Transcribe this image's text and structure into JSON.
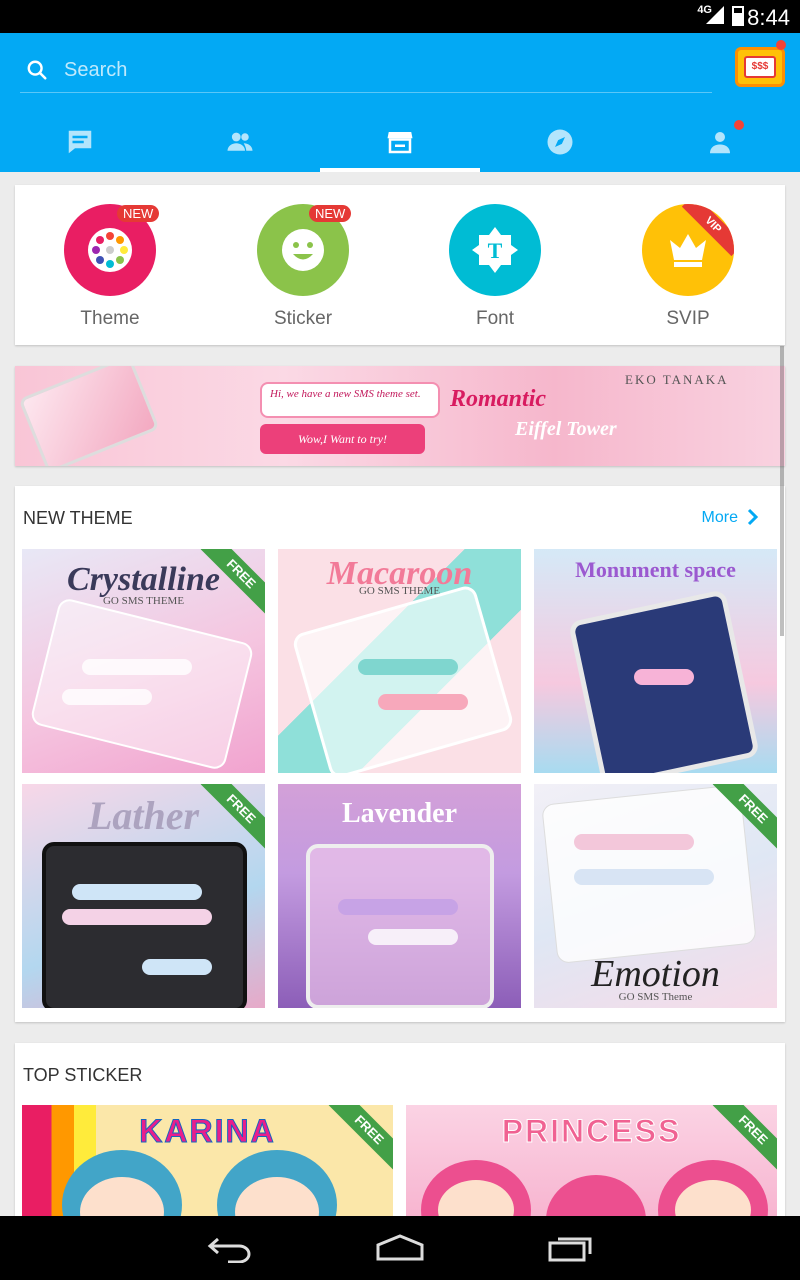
{
  "status_bar": {
    "network": "4G",
    "time": "8:44"
  },
  "search": {
    "placeholder": "Search"
  },
  "header": {
    "slot_label": "$$$"
  },
  "tabs": [
    {
      "name": "messages",
      "icon": "chat-icon"
    },
    {
      "name": "contacts",
      "icon": "people-icon"
    },
    {
      "name": "store",
      "icon": "store-icon",
      "active": true
    },
    {
      "name": "discover",
      "icon": "compass-icon"
    },
    {
      "name": "profile",
      "icon": "person-icon"
    }
  ],
  "categories": [
    {
      "label": "Theme",
      "badge": "NEW",
      "color": "#e91e63"
    },
    {
      "label": "Sticker",
      "badge": "NEW",
      "color": "#8bc34a"
    },
    {
      "label": "Font",
      "badge": "",
      "color": "#00bcd4"
    },
    {
      "label": "SVIP",
      "badge": "VIP",
      "color": "#ffc107"
    }
  ],
  "banner": {
    "bubble_text": "Hi, we have a new SMS theme set.",
    "button_text": "Wow,I Want to try!",
    "title_line1": "Romantic",
    "title_line2": "Eiffel Tower",
    "brand": "EKO TANAKA"
  },
  "new_theme": {
    "title": "NEW THEME",
    "more_label": "More",
    "free_label": "FREE",
    "themes": [
      {
        "title": "Crystalline",
        "subtitle": "GO SMS THEME",
        "free": true
      },
      {
        "title": "Macaroon",
        "subtitle": "GO SMS THEME",
        "free": false
      },
      {
        "title": "Monument space",
        "subtitle": "",
        "free": false
      },
      {
        "title": "Lather",
        "subtitle": "",
        "free": true
      },
      {
        "title": "Lavender",
        "subtitle": "",
        "free": false
      },
      {
        "title": "Emotion",
        "subtitle": "GO SMS Theme",
        "free": true
      }
    ]
  },
  "top_sticker": {
    "title": "TOP STICKER",
    "free_label": "FREE",
    "stickers": [
      {
        "title": "KARINA",
        "free": true
      },
      {
        "title": "PRINCESS",
        "free": true
      }
    ]
  },
  "colors": {
    "primary": "#03a9f4",
    "badge_red": "#e53935",
    "free_green": "#43a047"
  }
}
